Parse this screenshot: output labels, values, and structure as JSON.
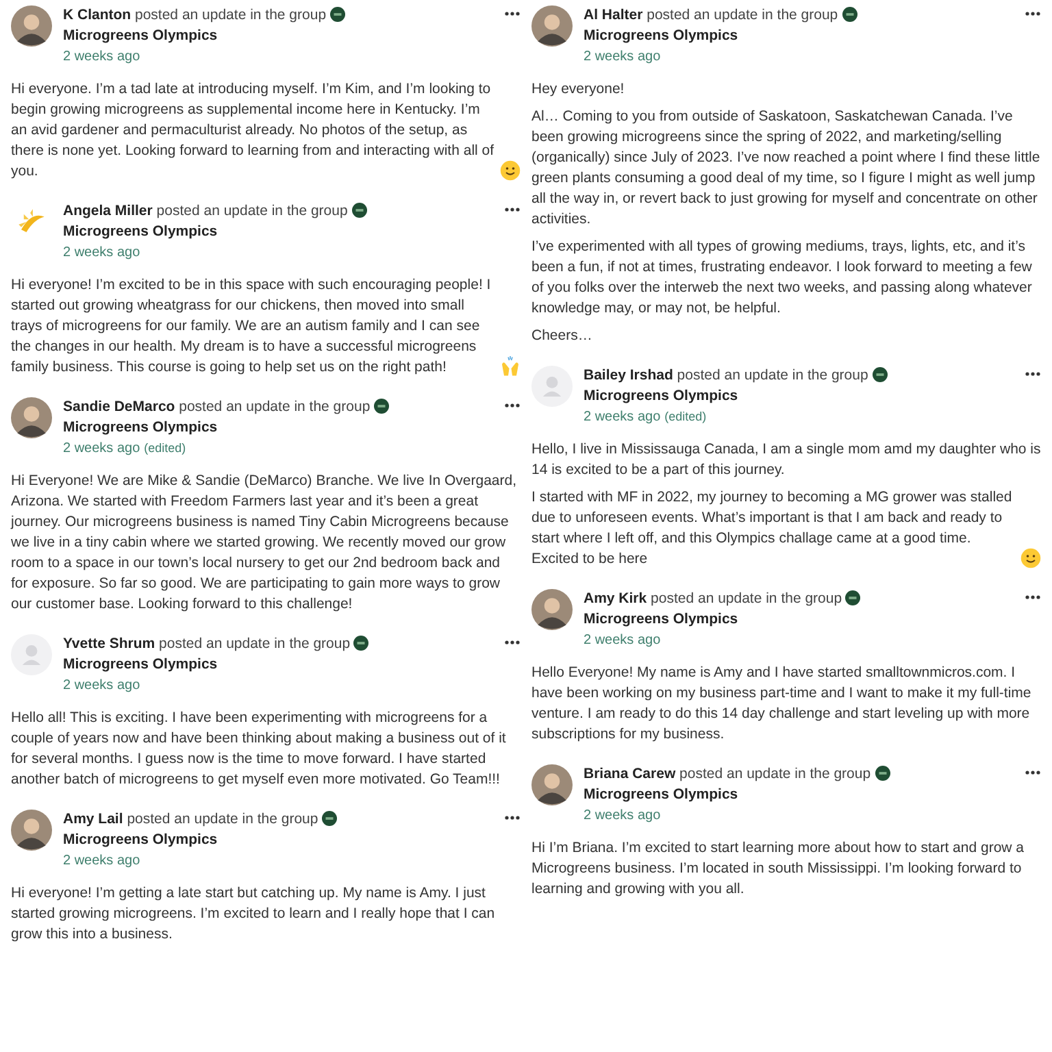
{
  "columns": [
    {
      "posts": [
        {
          "author": "K Clanton",
          "avatar": {
            "kind": "photo"
          },
          "action": "posted an update in the group",
          "group": "Microgreens Olympics",
          "time": "2 weeks ago",
          "paragraphs": [
            "Hi everyone. I’m a tad late at introducing myself. I’m Kim, and I’m looking to begin growing microgreens as supplemental income here in Kentucky. I’m an avid gardener and permaculturist already. No photos of the setup, as there is none yet. Looking forward to learning from and interacting with all of you."
          ],
          "emoji": {
            "kind": "smiley"
          }
        },
        {
          "author": "Angela Miller",
          "avatar": {
            "kind": "logo"
          },
          "action": "posted an update in the group",
          "group": "Microgreens Olympics",
          "time": "2 weeks ago",
          "paragraphs": [
            "Hi everyone! I’m excited to be in this space with such encouraging people! I started out growing wheatgrass for our chickens, then moved into small trays of microgreens for our family. We are an autism family and I can see the changes in our health. My dream is to have a successful microgreens family business. This course is going to help set us on the right path!"
          ],
          "emoji": {
            "kind": "raised-hands"
          }
        },
        {
          "author": "Sandie DeMarco",
          "avatar": {
            "kind": "photo"
          },
          "action": "posted an update in the group",
          "group": "Microgreens Olympics",
          "time": "2 weeks ago",
          "edited": "(edited)",
          "paragraphs": [
            "Hi Everyone! We are Mike & Sandie (DeMarco) Branche. We live In Overgaard, Arizona. We started with Freedom Farmers last year and it’s been a great journey. Our microgreens business is named Tiny Cabin Microgreens because we live in a tiny cabin where we started growing. We recently moved our grow room to a space in our town’s local nursery to get our 2nd bedroom back and for exposure. So far so good. We are participating to gain more ways to grow our customer base. Looking forward to this challenge!"
          ]
        },
        {
          "author": "Yvette Shrum",
          "avatar": {
            "kind": "default"
          },
          "action": "posted an update in the group",
          "group": "Microgreens Olympics",
          "time": "2 weeks ago",
          "paragraphs": [
            "Hello all! This is exciting. I have been experimenting with microgreens for a couple of years now and have been thinking about making a business out of it for several months. I guess now is the time to move forward. I have started another batch of microgreens to get myself even more motivated. Go Team!!!"
          ]
        },
        {
          "author": "Amy Lail",
          "avatar": {
            "kind": "photo"
          },
          "action": "posted an update in the group",
          "group": "Microgreens Olympics",
          "time": "2 weeks ago",
          "paragraphs": [
            "Hi everyone! I’m getting a late start but catching up. My name is Amy. I just started growing microgreens. I’m excited to learn and I really hope that I can grow this into a business."
          ]
        }
      ]
    },
    {
      "posts": [
        {
          "author": "Al Halter",
          "avatar": {
            "kind": "photo"
          },
          "action": "posted an update in the group",
          "group": "Microgreens Olympics",
          "time": "2 weeks ago",
          "paragraphs": [
            "Hey everyone!",
            "Al… Coming to you from outside of Saskatoon, Saskatchewan Canada. I’ve been growing microgreens since the spring of 2022, and marketing/selling (organically) since July of 2023. I’ve now reached a point where I find these little green plants consuming a good deal of my time, so I figure I might as well jump all the way in, or revert back to just growing for myself and concentrate on other activities.",
            "I’ve experimented with all types of growing mediums, trays, lights, etc, and it’s been a fun, if not at times, frustrating endeavor. I look forward to meeting a few of you folks over the interweb the next two weeks, and passing along whatever knowledge may, or may not, be helpful.",
            "Cheers…"
          ]
        },
        {
          "author": "Bailey Irshad",
          "avatar": {
            "kind": "default"
          },
          "action": "posted an update in the group",
          "group": "Microgreens Olympics",
          "time": "2 weeks ago",
          "edited": "(edited)",
          "paragraphs": [
            "Hello, I live in Mississauga Canada, I am a single mom amd my daughter who is 14 is excited to be a part of this journey.",
            "I started with MF in 2022, my journey to becoming a MG grower was stalled due to unforeseen events. What’s important is that I am back and ready to start where I left off, and this Olympics challage came at a good time. Excited to be here"
          ],
          "emoji": {
            "kind": "smiley"
          }
        },
        {
          "author": "Amy Kirk",
          "avatar": {
            "kind": "photo"
          },
          "action": "posted an update in the group",
          "group": "Microgreens Olympics",
          "time": "2 weeks ago",
          "paragraphs": [
            "Hello Everyone! My name is Amy and I have started smalltownmicros.com. I have been working on my business part-time and I want to make it my full-time venture. I am ready to do this 14 day challenge and start leveling up with more subscriptions for my business."
          ]
        },
        {
          "author": "Briana Carew",
          "avatar": {
            "kind": "photo"
          },
          "action": "posted an update in the group",
          "group": "Microgreens Olympics",
          "time": "2 weeks ago",
          "paragraphs": [
            "Hi I’m Briana. I’m excited to start learning more about how to start and grow a Microgreens business. I’m located in south Mississippi. I’m looking forward to learning and growing with you all."
          ]
        }
      ]
    }
  ]
}
